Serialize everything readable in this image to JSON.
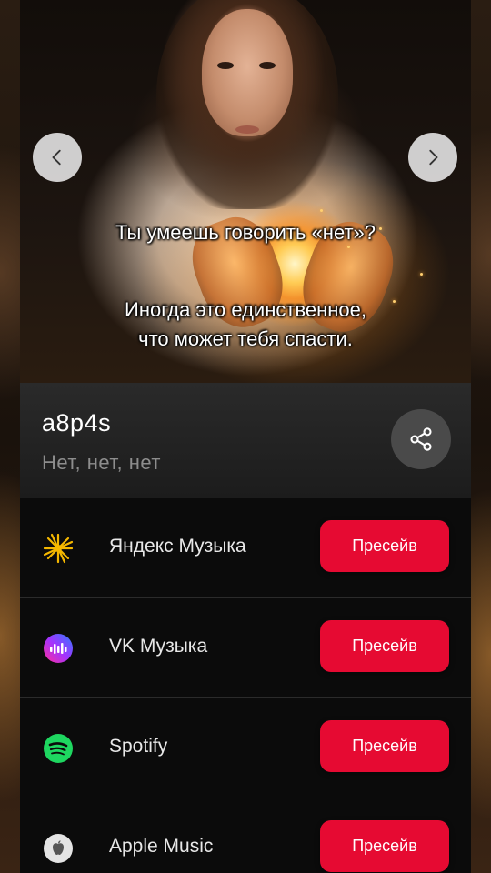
{
  "hero": {
    "caption_line1": "Ты умеешь говорить «нет»?",
    "caption_line2": "Иногда это единственное,",
    "caption_line3": "что может тебя спасти."
  },
  "release": {
    "artist": "a8p4s",
    "title": "Нет, нет, нет"
  },
  "services": [
    {
      "name": "Яндекс Музыка",
      "icon": "yandex-music-star-icon",
      "button": "Пресейв"
    },
    {
      "name": "VK Музыка",
      "icon": "vk-music-wave-icon",
      "button": "Пресейв"
    },
    {
      "name": "Spotify",
      "icon": "spotify-icon",
      "button": "Пресейв"
    },
    {
      "name": "Apple Music",
      "icon": "apple-music-icon",
      "button": "Пресейв"
    }
  ],
  "colors": {
    "presave_button": "#e60a32",
    "card_background": "#0b0b0b",
    "info_panel": "#2a2a2a",
    "subtitle_text": "#8d8d8d"
  }
}
